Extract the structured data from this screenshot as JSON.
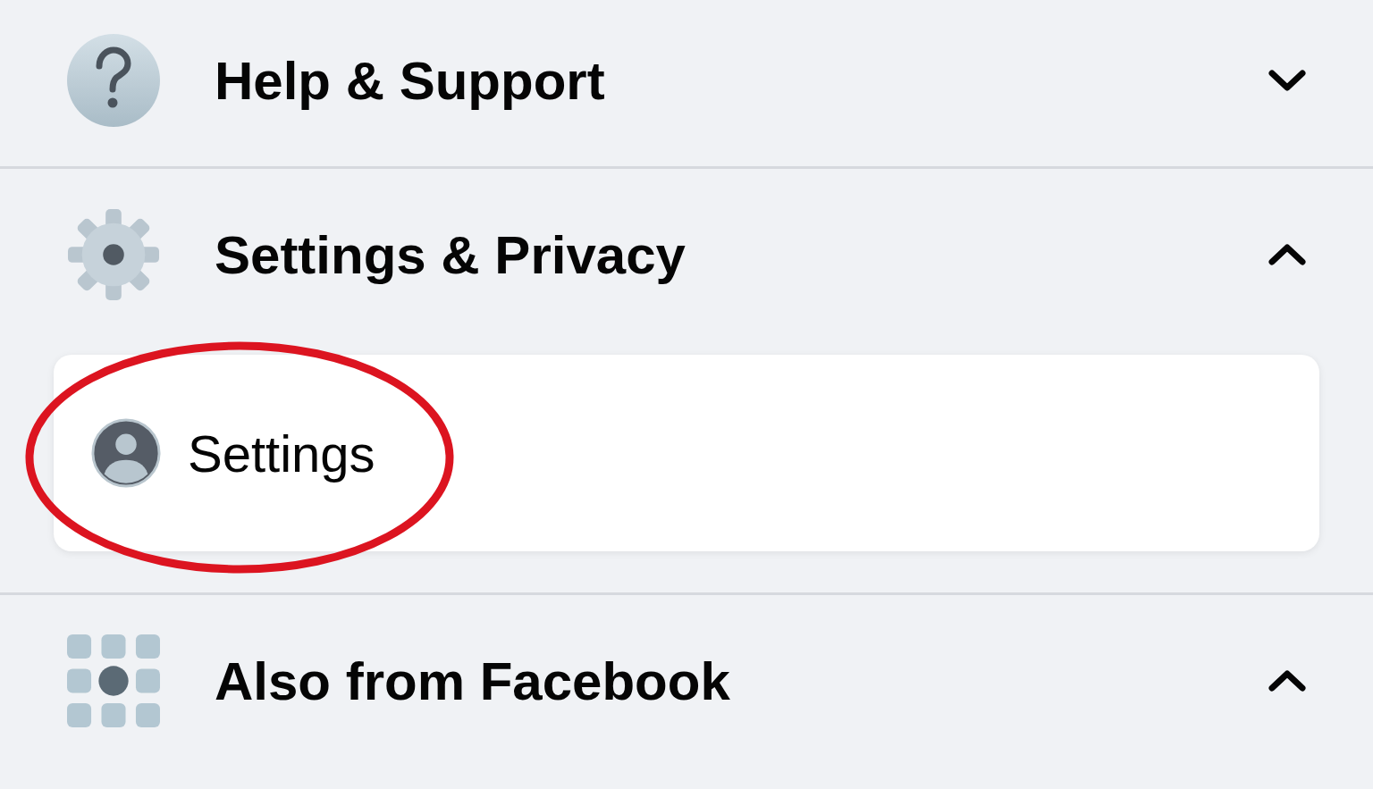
{
  "menu": [
    {
      "kind": "help",
      "label": "Help & Support",
      "expanded": false
    },
    {
      "kind": "settings",
      "label": "Settings & Privacy",
      "expanded": true,
      "items": [
        {
          "kind": "account",
          "label": "Settings",
          "circled": true
        }
      ]
    },
    {
      "kind": "apps",
      "label": "Also from Facebook",
      "expanded": true
    }
  ]
}
